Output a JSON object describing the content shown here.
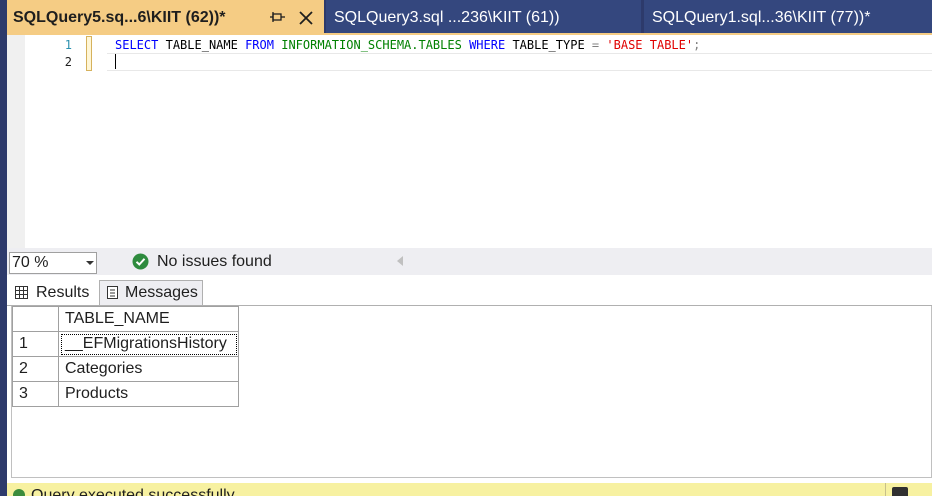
{
  "tabs": [
    {
      "label": "SQLQuery5.sq...6\\KIIT (62))*",
      "active": true
    },
    {
      "label": "SQLQuery3.sql ...236\\KIIT (61))",
      "active": false
    },
    {
      "label": "SQLQuery1.sql...36\\KIIT (77))*",
      "active": false
    }
  ],
  "editor": {
    "line_numbers": [
      "1",
      "2"
    ],
    "code": {
      "select": "SELECT",
      "table_name": "TABLE_NAME",
      "from": "FROM",
      "schema": "INFORMATION_SCHEMA.TABLES",
      "where": "WHERE",
      "table_type": "TABLE_TYPE",
      "eq": "=",
      "literal": "'BASE TABLE'",
      "semicolon": ";"
    }
  },
  "status": {
    "zoom": "70 %",
    "issues": "No issues found"
  },
  "result_tabs": {
    "results": "Results",
    "messages": "Messages"
  },
  "grid": {
    "column_header": "TABLE_NAME",
    "rows": [
      {
        "num": "1",
        "value": "__EFMigrationsHistory"
      },
      {
        "num": "2",
        "value": "Categories"
      },
      {
        "num": "3",
        "value": "Products"
      }
    ]
  },
  "bottom_status": {
    "text": "Query executed successfully."
  },
  "colors": {
    "active_tab": "#f5cc84",
    "inactive_tab": "#34477e",
    "frame": "#2d3a6b",
    "status_bar": "#f7f1a1",
    "keyword": "#0000ff",
    "object": "#008000",
    "string": "#e00000"
  }
}
